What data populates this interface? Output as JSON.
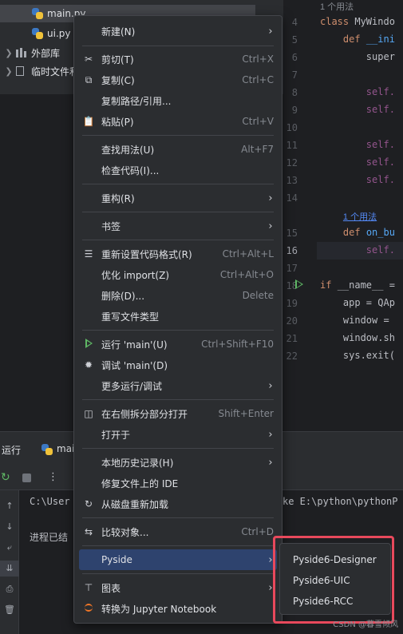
{
  "tree": {
    "items": [
      {
        "label": "main.py"
      },
      {
        "label": "ui.py"
      },
      {
        "label": "外部库"
      },
      {
        "label": "临时文件和"
      }
    ]
  },
  "editor": {
    "line_numbers": [
      "4",
      "5",
      "6",
      "7",
      "8",
      "9",
      "10",
      "11",
      "12",
      "13",
      "14",
      "15",
      "16",
      "17",
      "18",
      "19",
      "20",
      "21",
      "22"
    ],
    "usage_hint_1": "1 个用法",
    "usage_hint_2": "1 个用法",
    "lines": {
      "class_kw": "class ",
      "class_name": "MyWindo",
      "def1_kw": "def ",
      "def1_name": "__ini",
      "super": "super",
      "self_a": "self.",
      "self_b": "self.",
      "self_c": "self.",
      "self_d": "self.",
      "self_e": "self.",
      "def2_kw": "def ",
      "def2_name": "on_bu",
      "self_f": "self.",
      "if_kw": "if ",
      "if_rest": "__name__ =",
      "app": "app = QAp",
      "window": "window = ",
      "window_show": "window.sh",
      "sys_exit": "sys.exit("
    }
  },
  "run_panel": {
    "tab_run": "运行",
    "tab_main": "mai",
    "console_line1": "C:\\User",
    "console_line1_right": "ke E:\\python\\pythonP",
    "console_line2": "进程已结"
  },
  "context_menu": {
    "new": "新建(N)",
    "cut": "剪切(T)",
    "cut_sc": "Ctrl+X",
    "copy": "复制(C)",
    "copy_sc": "Ctrl+C",
    "copy_path": "复制路径/引用...",
    "paste": "粘贴(P)",
    "paste_sc": "Ctrl+V",
    "find_usages": "查找用法(U)",
    "find_usages_sc": "Alt+F7",
    "inspect": "检查代码(I)...",
    "refactor": "重构(R)",
    "bookmarks": "书签",
    "reformat": "重新设置代码格式(R)",
    "reformat_sc": "Ctrl+Alt+L",
    "optimize": "优化 import(Z)",
    "optimize_sc": "Ctrl+Alt+O",
    "delete": "删除(D)...",
    "delete_sc": "Delete",
    "override_type": "重写文件类型",
    "run_main": "运行 'main'(U)",
    "run_main_sc": "Ctrl+Shift+F10",
    "debug_main": "调试 'main'(D)",
    "more_run": "更多运行/调试",
    "open_split": "在右侧拆分部分打开",
    "open_split_sc": "Shift+Enter",
    "open_in": "打开于",
    "local_history": "本地历史记录(H)",
    "fix_ide": "修复文件上的 IDE",
    "reload": "从磁盘重新加载",
    "compare": "比较对象...",
    "compare_sc": "Ctrl+D",
    "pyside": "Pyside",
    "diagrams": "图表",
    "jupyter": "转换为 Jupyter Notebook"
  },
  "submenu": {
    "items": [
      "Pyside6-Designer",
      "Pyside6-UIC",
      "Pyside6-RCC"
    ]
  },
  "watermark": "CSDN @暮雪倾风"
}
